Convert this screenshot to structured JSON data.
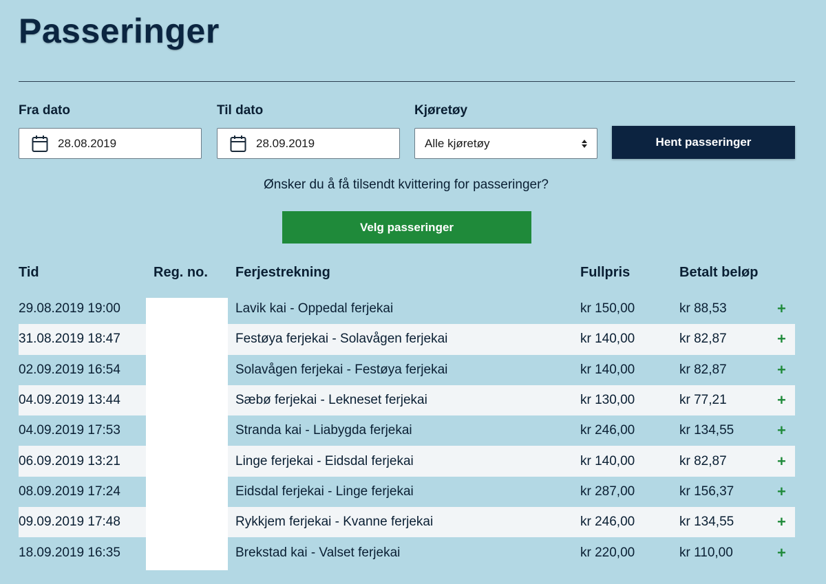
{
  "page": {
    "title": "Passeringer"
  },
  "filters": {
    "from_label": "Fra dato",
    "from_value": "28.08.2019",
    "to_label": "Til dato",
    "to_value": "28.09.2019",
    "vehicle_label": "Kjøretøy",
    "vehicle_value": "Alle kjøretøy",
    "fetch_button": "Hent passeringer"
  },
  "receipt": {
    "question": "Ønsker du å få tilsendt kvittering for passeringer?",
    "select_button": "Velg passeringer"
  },
  "table": {
    "headers": [
      "Tid",
      "Reg. no.",
      "Ferjestrekning",
      "Fullpris",
      "Betalt beløp"
    ],
    "rows": [
      {
        "tid": "29.08.2019 19:00",
        "strekning": "Lavik kai - Oppedal ferjekai",
        "fullpris": "kr 150,00",
        "betalt": "kr 88,53"
      },
      {
        "tid": "31.08.2019 18:47",
        "strekning": "Festøya ferjekai - Solavågen ferjekai",
        "fullpris": "kr 140,00",
        "betalt": "kr 82,87"
      },
      {
        "tid": "02.09.2019 16:54",
        "strekning": "Solavågen ferjekai - Festøya ferjekai",
        "fullpris": "kr 140,00",
        "betalt": "kr 82,87"
      },
      {
        "tid": "04.09.2019 13:44",
        "strekning": "Sæbø ferjekai - Lekneset ferjekai",
        "fullpris": "kr 130,00",
        "betalt": "kr 77,21"
      },
      {
        "tid": "04.09.2019 17:53",
        "strekning": "Stranda kai - Liabygda ferjekai",
        "fullpris": "kr 246,00",
        "betalt": "kr 134,55"
      },
      {
        "tid": "06.09.2019 13:21",
        "strekning": "Linge ferjekai - Eidsdal ferjekai",
        "fullpris": "kr 140,00",
        "betalt": "kr 82,87"
      },
      {
        "tid": "08.09.2019 17:24",
        "strekning": "Eidsdal ferjekai - Linge ferjekai",
        "fullpris": "kr 287,00",
        "betalt": "kr 156,37"
      },
      {
        "tid": "09.09.2019 17:48",
        "strekning": "Rykkjem ferjekai - Kvanne ferjekai",
        "fullpris": "kr 246,00",
        "betalt": "kr 134,55"
      },
      {
        "tid": "18.09.2019 16:35",
        "strekning": "Brekstad kai - Valset ferjekai",
        "fullpris": "kr 220,00",
        "betalt": "kr 110,00"
      }
    ],
    "expand_symbol": "+"
  },
  "icons": {
    "calendar": "calendar-icon",
    "select_arrows": "select-arrows-icon",
    "expand": "plus-icon"
  },
  "colors": {
    "background": "#b3d8e4",
    "primary_button": "#0c2340",
    "green_button": "#1f8a3a",
    "alt_row": "#f2f5f7"
  }
}
